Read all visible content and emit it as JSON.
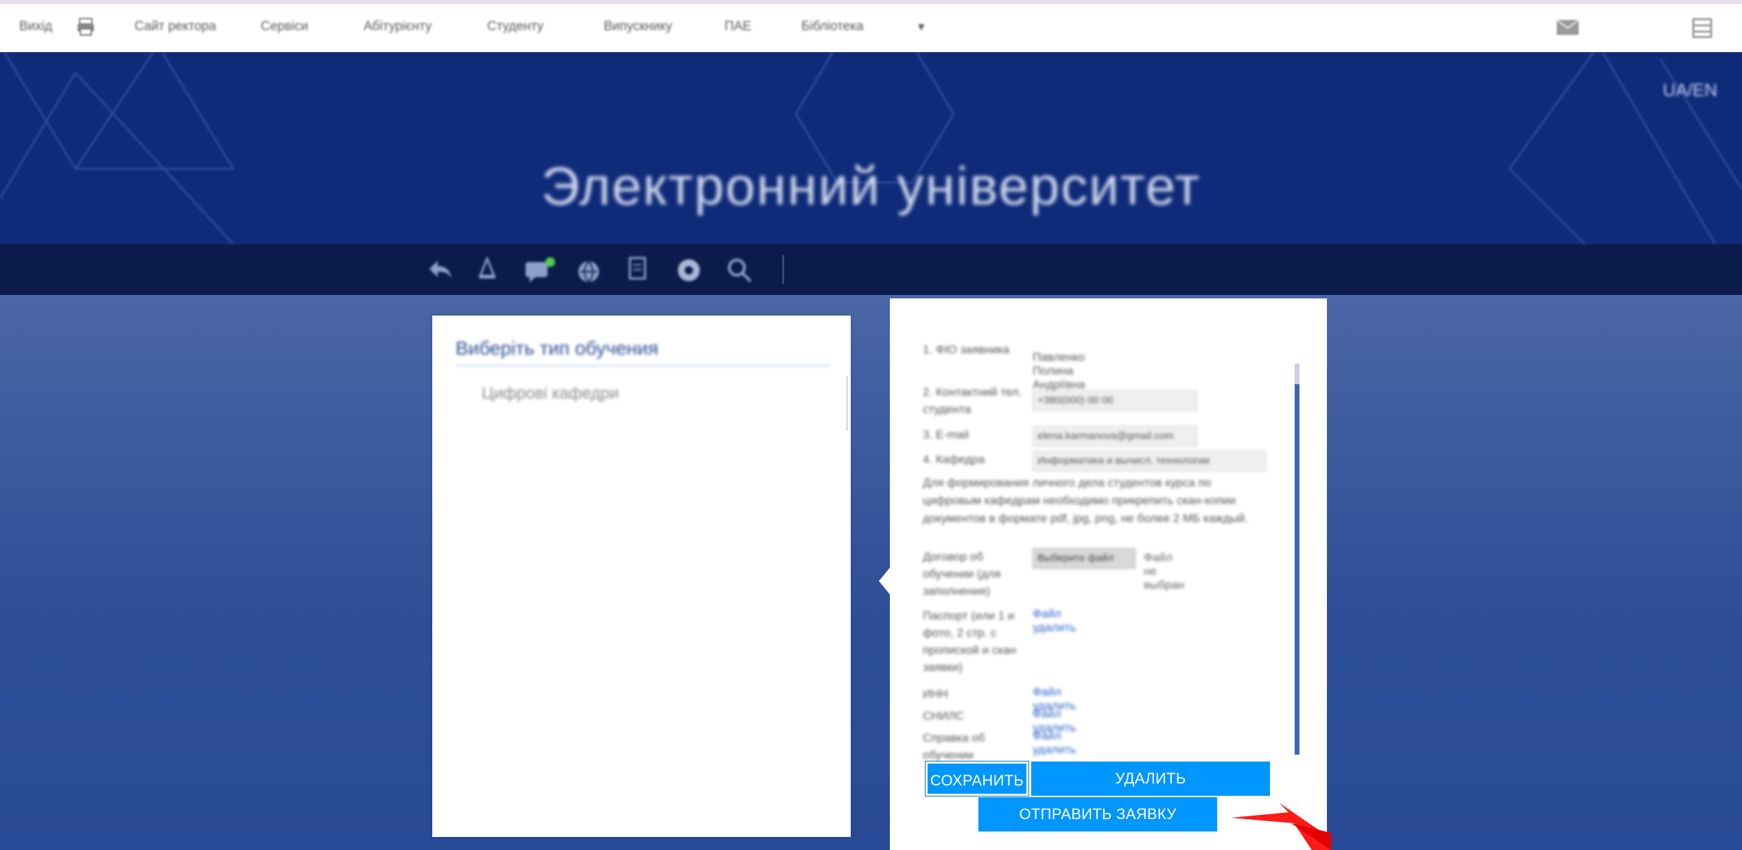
{
  "topnav": {
    "items": [
      "Вихід",
      "Сайт ректора",
      "Сервіси",
      "Абітурієнту",
      "Студенту",
      "Випускнику",
      "ПАЕ",
      "Бібліотека",
      "▾"
    ]
  },
  "banner": {
    "title": "Электронний університет",
    "lang": "UA/EN"
  },
  "left_panel": {
    "title": "Виберіть тип обучения",
    "items": [
      "Цифрові кафедри"
    ]
  },
  "form": {
    "rows": [
      {
        "label": "1. ФІО заявника",
        "value": "Павленко Полина Андріївна"
      },
      {
        "label": "2. Контактний тел. студента",
        "value": "+380(000) 00 00"
      },
      {
        "label": "3. Е-mail",
        "value": "elena.karmanova@gmail.com"
      },
      {
        "label": "4. Кафедра",
        "value": "Информатика и вычисл. технологии"
      }
    ],
    "note": "Для формирования личного дела студентов курса по цифровым кафедрам необходимо прикрепить скан-копии документов в формате pdf, jpg, png, не более 2 МБ каждый.",
    "file_row": {
      "label": "Договор об обучении (для заполнения)",
      "button": "Выберите файл",
      "none": "Файл не выбран"
    },
    "passport_row": {
      "label": "Паспорт (или 1 и фото, 2 стр. с пропиской и скан заявки)",
      "link": "Файл удалить"
    },
    "link_rows": [
      {
        "label": "ИНН",
        "link": "Файл удалить"
      },
      {
        "label": "СНИЛС",
        "link": "Файл удалить"
      },
      {
        "label": "Справка об обучении",
        "link": "Файл удалить"
      }
    ]
  },
  "buttons": {
    "save": "СОХРАНИТЬ",
    "delete": "УДАЛИТЬ",
    "send": "ОТПРАВИТЬ ЗАЯВКУ"
  },
  "colors": {
    "banner": "#0f2a78",
    "toolbar": "#0b1c4c",
    "button": "#0096ff",
    "arrow": "#ff1a1a"
  }
}
